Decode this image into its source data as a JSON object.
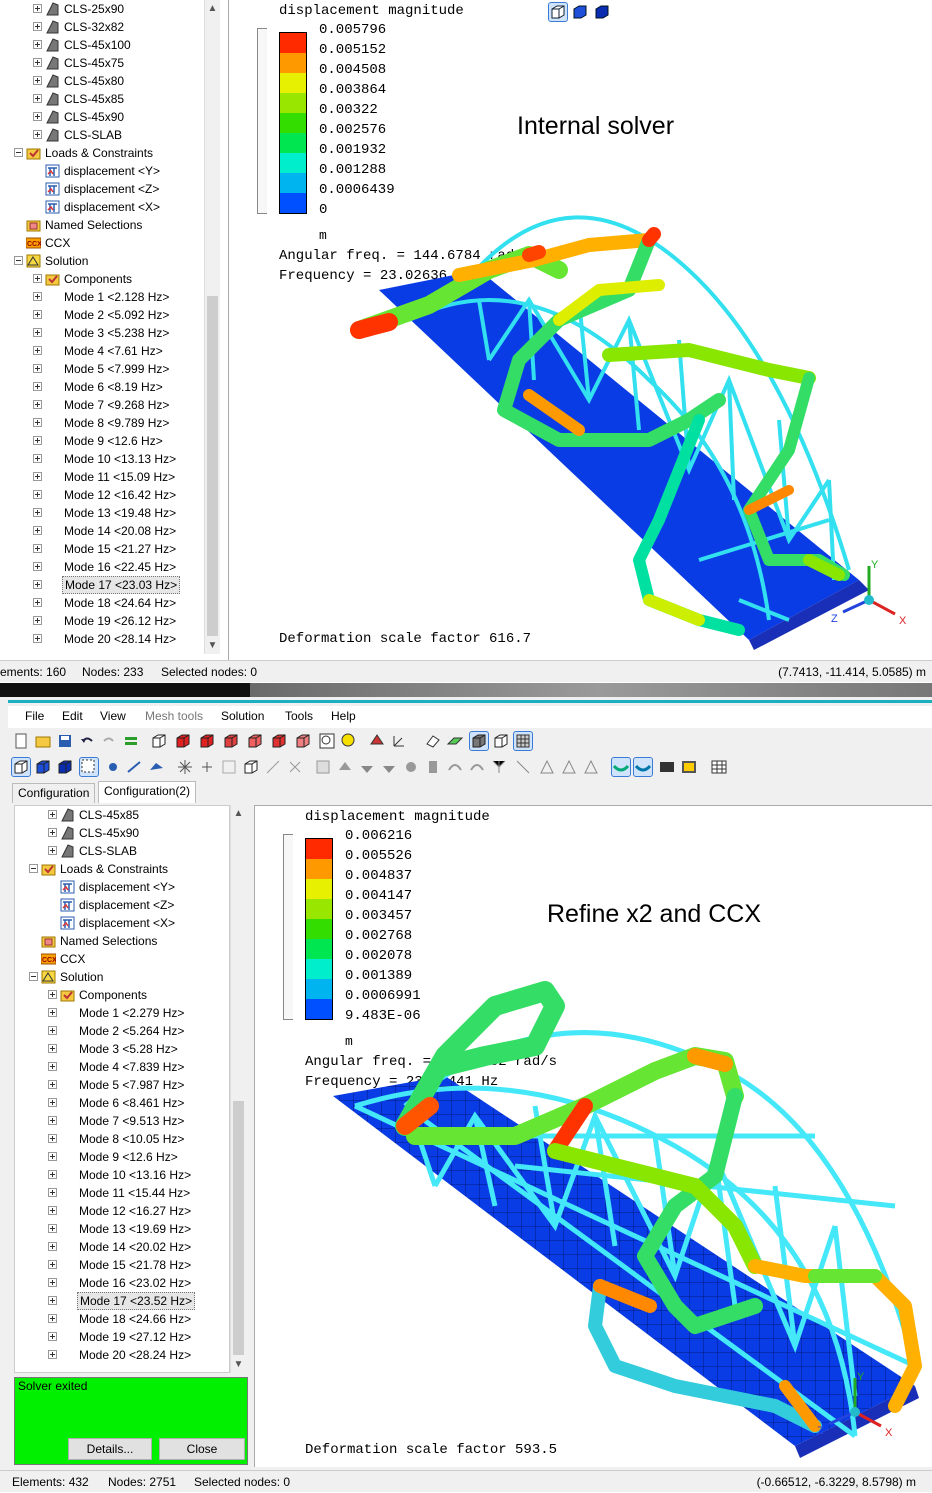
{
  "top": {
    "tree": [
      {
        "label": "CLS-25x90",
        "level": 2,
        "icon": "section-icon",
        "expand": "plus"
      },
      {
        "label": "CLS-32x82",
        "level": 2,
        "icon": "section-icon",
        "expand": "plus"
      },
      {
        "label": "CLS-45x100",
        "level": 2,
        "icon": "section-icon",
        "expand": "plus"
      },
      {
        "label": "CLS-45x75",
        "level": 2,
        "icon": "section-icon",
        "expand": "plus"
      },
      {
        "label": "CLS-45x80",
        "level": 2,
        "icon": "section-icon",
        "expand": "plus"
      },
      {
        "label": "CLS-45x85",
        "level": 2,
        "icon": "section-icon",
        "expand": "plus"
      },
      {
        "label": "CLS-45x90",
        "level": 2,
        "icon": "section-icon",
        "expand": "plus"
      },
      {
        "label": "CLS-SLAB",
        "level": 2,
        "icon": "section-icon",
        "expand": "plus"
      },
      {
        "label": "Loads & Constraints",
        "level": 1,
        "icon": "folder-icon",
        "expand": "minus"
      },
      {
        "label": "displacement <Y>",
        "level": 2,
        "icon": "constraint-icon",
        "expand": ""
      },
      {
        "label": "displacement <Z>",
        "level": 2,
        "icon": "constraint-icon",
        "expand": ""
      },
      {
        "label": "displacement <X>",
        "level": 2,
        "icon": "constraint-icon",
        "expand": ""
      },
      {
        "label": "Named Selections",
        "level": 1,
        "icon": "named-selection-icon",
        "expand": ""
      },
      {
        "label": "CCX",
        "level": 1,
        "icon": "ccx-icon",
        "expand": ""
      },
      {
        "label": "Solution",
        "level": 1,
        "icon": "solution-icon",
        "expand": "minus"
      },
      {
        "label": "Components",
        "level": 2,
        "icon": "folder-icon",
        "expand": "plus"
      },
      {
        "label": "Mode 1 <2.128 Hz>",
        "level": 2,
        "icon": "",
        "expand": "plus"
      },
      {
        "label": "Mode 2 <5.092 Hz>",
        "level": 2,
        "icon": "",
        "expand": "plus"
      },
      {
        "label": "Mode 3 <5.238 Hz>",
        "level": 2,
        "icon": "",
        "expand": "plus"
      },
      {
        "label": "Mode 4 <7.61 Hz>",
        "level": 2,
        "icon": "",
        "expand": "plus"
      },
      {
        "label": "Mode 5 <7.999 Hz>",
        "level": 2,
        "icon": "",
        "expand": "plus"
      },
      {
        "label": "Mode 6 <8.19 Hz>",
        "level": 2,
        "icon": "",
        "expand": "plus"
      },
      {
        "label": "Mode 7 <9.268 Hz>",
        "level": 2,
        "icon": "",
        "expand": "plus"
      },
      {
        "label": "Mode 8 <9.789 Hz>",
        "level": 2,
        "icon": "",
        "expand": "plus"
      },
      {
        "label": "Mode 9 <12.6 Hz>",
        "level": 2,
        "icon": "",
        "expand": "plus"
      },
      {
        "label": "Mode 10 <13.13 Hz>",
        "level": 2,
        "icon": "",
        "expand": "plus"
      },
      {
        "label": "Mode 11 <15.09 Hz>",
        "level": 2,
        "icon": "",
        "expand": "plus"
      },
      {
        "label": "Mode 12 <16.42 Hz>",
        "level": 2,
        "icon": "",
        "expand": "plus"
      },
      {
        "label": "Mode 13 <19.48 Hz>",
        "level": 2,
        "icon": "",
        "expand": "plus"
      },
      {
        "label": "Mode 14 <20.08 Hz>",
        "level": 2,
        "icon": "",
        "expand": "plus"
      },
      {
        "label": "Mode 15 <21.27 Hz>",
        "level": 2,
        "icon": "",
        "expand": "plus"
      },
      {
        "label": "Mode 16 <22.45 Hz>",
        "level": 2,
        "icon": "",
        "expand": "plus"
      },
      {
        "label": "Mode 17 <23.03 Hz>",
        "level": 2,
        "icon": "",
        "expand": "plus",
        "selected": true
      },
      {
        "label": "Mode 18 <24.64 Hz>",
        "level": 2,
        "icon": "",
        "expand": "plus"
      },
      {
        "label": "Mode 19 <26.12 Hz>",
        "level": 2,
        "icon": "",
        "expand": "plus"
      },
      {
        "label": "Mode 20 <28.14 Hz>",
        "level": 2,
        "icon": "",
        "expand": "plus"
      }
    ],
    "legend_title": "displacement magnitude",
    "legend_values": [
      "0.005796",
      "0.005152",
      "0.004508",
      "0.003864",
      "0.00322",
      "0.002576",
      "0.001932",
      "0.001288",
      "0.0006439",
      "0"
    ],
    "unit": "m",
    "angular_freq": "Angular freq. = 144.6784 rad/s",
    "frequency": "Frequency = 23.02636 Hz",
    "annotation": "Internal solver",
    "deformation": "Deformation scale factor 616.7",
    "status": {
      "elements": "ements: 160",
      "nodes": "Nodes: 233",
      "selected": "Selected nodes: 0",
      "coords": "(7.7413, -11.414, 5.0585) m"
    }
  },
  "bottom": {
    "menu": [
      "File",
      "Edit",
      "View",
      "Mesh tools",
      "Solution",
      "Tools",
      "Help"
    ],
    "tabs": [
      "Configuration",
      "Configuration(2)"
    ],
    "tree": [
      {
        "label": "CLS-45x85",
        "level": 2,
        "icon": "section-icon",
        "expand": "plus"
      },
      {
        "label": "CLS-45x90",
        "level": 2,
        "icon": "section-icon",
        "expand": "plus"
      },
      {
        "label": "CLS-SLAB",
        "level": 2,
        "icon": "section-icon",
        "expand": "plus"
      },
      {
        "label": "Loads & Constraints",
        "level": 1,
        "icon": "folder-icon",
        "expand": "minus"
      },
      {
        "label": "displacement <Y>",
        "level": 2,
        "icon": "constraint-icon",
        "expand": ""
      },
      {
        "label": "displacement <Z>",
        "level": 2,
        "icon": "constraint-icon",
        "expand": ""
      },
      {
        "label": "displacement <X>",
        "level": 2,
        "icon": "constraint-icon",
        "expand": ""
      },
      {
        "label": "Named Selections",
        "level": 1,
        "icon": "named-selection-icon",
        "expand": ""
      },
      {
        "label": "CCX",
        "level": 1,
        "icon": "ccx-icon",
        "expand": ""
      },
      {
        "label": "Solution",
        "level": 1,
        "icon": "solution-icon",
        "expand": "minus"
      },
      {
        "label": "Components",
        "level": 2,
        "icon": "folder-icon",
        "expand": "plus"
      },
      {
        "label": "Mode 1 <2.279 Hz>",
        "level": 2,
        "icon": "",
        "expand": "plus"
      },
      {
        "label": "Mode 2 <5.264 Hz>",
        "level": 2,
        "icon": "",
        "expand": "plus"
      },
      {
        "label": "Mode 3 <5.28 Hz>",
        "level": 2,
        "icon": "",
        "expand": "plus"
      },
      {
        "label": "Mode 4 <7.839 Hz>",
        "level": 2,
        "icon": "",
        "expand": "plus"
      },
      {
        "label": "Mode 5 <7.987 Hz>",
        "level": 2,
        "icon": "",
        "expand": "plus"
      },
      {
        "label": "Mode 6 <8.461 Hz>",
        "level": 2,
        "icon": "",
        "expand": "plus"
      },
      {
        "label": "Mode 7 <9.513 Hz>",
        "level": 2,
        "icon": "",
        "expand": "plus"
      },
      {
        "label": "Mode 8 <10.05 Hz>",
        "level": 2,
        "icon": "",
        "expand": "plus"
      },
      {
        "label": "Mode 9 <12.6 Hz>",
        "level": 2,
        "icon": "",
        "expand": "plus"
      },
      {
        "label": "Mode 10 <13.16 Hz>",
        "level": 2,
        "icon": "",
        "expand": "plus"
      },
      {
        "label": "Mode 11 <15.44 Hz>",
        "level": 2,
        "icon": "",
        "expand": "plus"
      },
      {
        "label": "Mode 12 <16.27 Hz>",
        "level": 2,
        "icon": "",
        "expand": "plus"
      },
      {
        "label": "Mode 13 <19.69 Hz>",
        "level": 2,
        "icon": "",
        "expand": "plus"
      },
      {
        "label": "Mode 14 <20.02 Hz>",
        "level": 2,
        "icon": "",
        "expand": "plus"
      },
      {
        "label": "Mode 15 <21.78 Hz>",
        "level": 2,
        "icon": "",
        "expand": "plus"
      },
      {
        "label": "Mode 16 <23.02 Hz>",
        "level": 2,
        "icon": "",
        "expand": "plus"
      },
      {
        "label": "Mode 17 <23.52 Hz>",
        "level": 2,
        "icon": "",
        "expand": "plus",
        "selected": true
      },
      {
        "label": "Mode 18 <24.66 Hz>",
        "level": 2,
        "icon": "",
        "expand": "plus"
      },
      {
        "label": "Mode 19 <27.12 Hz>",
        "level": 2,
        "icon": "",
        "expand": "plus"
      },
      {
        "label": "Mode 20 <28.24 Hz>",
        "level": 2,
        "icon": "",
        "expand": "plus"
      }
    ],
    "legend_title": "displacement magnitude",
    "legend_values": [
      "0.006216",
      "0.005526",
      "0.004837",
      "0.004147",
      "0.003457",
      "0.002768",
      "0.002078",
      "0.001389",
      "0.0006991",
      "9.483E-06"
    ],
    "unit": "m",
    "angular_freq": "Angular freq. = 147.8082 rad/s",
    "frequency": "Frequency = 23.52441 Hz",
    "annotation": "Refine x2 and CCX",
    "deformation": "Deformation scale factor 593.5",
    "message": "Solver exited",
    "details_label": "Details...",
    "close_label": "Close",
    "status": {
      "elements": "Elements: 432",
      "nodes": "Nodes: 2751",
      "selected": "Selected nodes: 0",
      "coords": "(-0.66512, -6.3229, 8.5798) m"
    }
  },
  "legend_colors": [
    "#ff2a00",
    "#ff9900",
    "#e6f000",
    "#99e600",
    "#33dd00",
    "#00e650",
    "#00eecc",
    "#00b4f0",
    "#0050ff"
  ],
  "axes": {
    "x": "X",
    "y": "Y",
    "z": "Z"
  }
}
